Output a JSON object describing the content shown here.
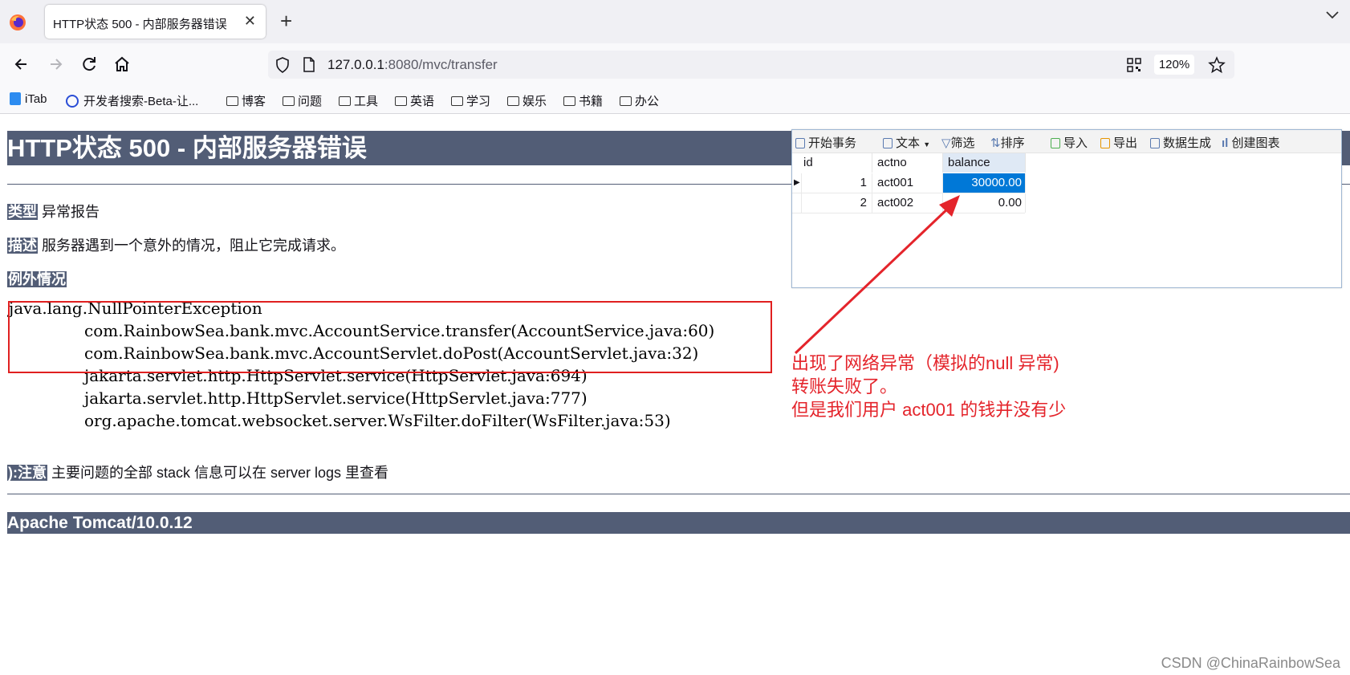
{
  "browser": {
    "tab_title": "HTTP状态 500 - 内部服务器错误",
    "url_host": "127.0.0.1",
    "url_rest": ":8080/mvc/transfer",
    "zoom": "120%",
    "bookmarks": [
      "iTab",
      "开发者搜索-Beta-让...",
      "博客",
      "问题",
      "工具",
      "英语",
      "学习",
      "娱乐",
      "书籍",
      "办公"
    ]
  },
  "page": {
    "title": "HTTP状态 500 - 内部服务器错误",
    "type_label": "类型",
    "type_value": "异常报告",
    "desc_label": "描述",
    "desc_value": "服务器遇到一个意外的情况，阻止它完成请求。",
    "exception_label": "例外情况",
    "stack": [
      "java.lang.NullPointerException",
      "\tcom.RainbowSea.bank.mvc.AccountService.transfer(AccountService.java:60)",
      "\tcom.RainbowSea.bank.mvc.AccountServlet.doPost(AccountServlet.java:32)",
      "\tjakarta.servlet.http.HttpServlet.service(HttpServlet.java:694)",
      "\tjakarta.servlet.http.HttpServlet.service(HttpServlet.java:777)",
      "\torg.apache.tomcat.websocket.server.WsFilter.doFilter(WsFilter.java:53)"
    ],
    "note_label": "):注意",
    "note_value": "主要问题的全部 stack 信息可以在 server logs 里查看",
    "footer": "Apache Tomcat/10.0.12"
  },
  "db": {
    "toolbar": [
      "开始事务",
      "文本",
      "筛选",
      "排序",
      "导入",
      "导出",
      "数据生成",
      "创建图表"
    ],
    "columns": [
      "id",
      "actno",
      "balance"
    ],
    "rows": [
      {
        "id": "1",
        "actno": "act001",
        "balance": "30000.00"
      },
      {
        "id": "2",
        "actno": "act002",
        "balance": "0.00"
      }
    ]
  },
  "annotation": [
    "出现了网络异常（模拟的null 异常)",
    "转账失败了。",
    "但是我们用户 act001 的钱并没有少"
  ],
  "watermark": "CSDN @ChinaRainbowSea",
  "colors": {
    "tomcat_header": "#525d76",
    "annotation_red": "#e4242b",
    "selection_blue": "#0078d7"
  }
}
